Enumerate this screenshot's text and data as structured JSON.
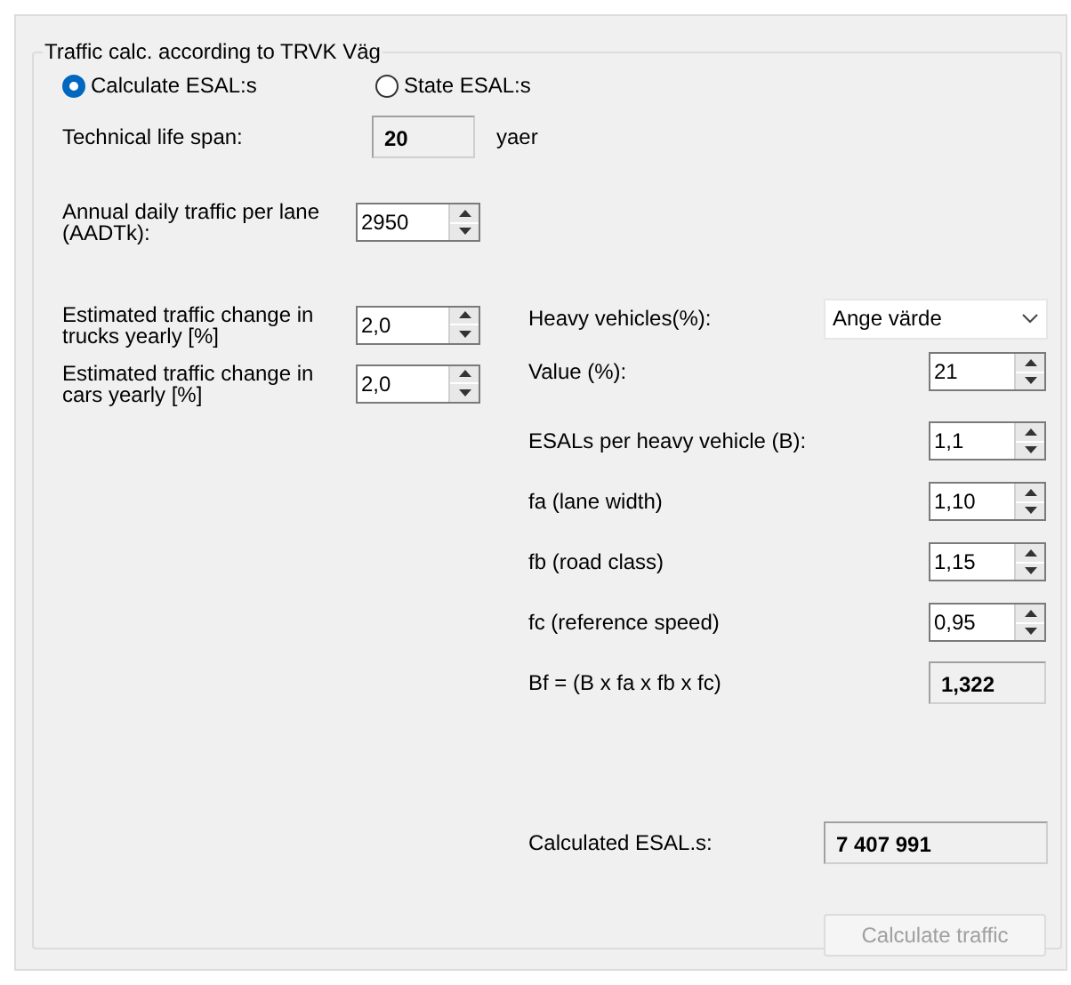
{
  "group_title": "Traffic calc. according to TRVK Väg",
  "modes": [
    {
      "label": "Calculate ESAL:s",
      "selected": true
    },
    {
      "label": "State ESAL:s",
      "selected": false
    }
  ],
  "life_span": {
    "label": "Technical life span:",
    "value": "20",
    "unit": "yaer"
  },
  "aadt": {
    "label": "Annual daily traffic per lane (AADTk):",
    "value": "2950"
  },
  "changes": [
    {
      "label": "Estimated traffic change in trucks yearly [%]",
      "value": "2,0"
    },
    {
      "label": "Estimated traffic change in cars yearly [%]",
      "value": "2,0"
    }
  ],
  "heavy": {
    "label": "Heavy vehicles(%):",
    "value": "Ange värde"
  },
  "params": [
    {
      "label": "Value (%):",
      "value": "21",
      "kind": "spin"
    },
    {
      "label": "ESALs per heavy vehicle (B):",
      "value": "1,1",
      "kind": "spin"
    },
    {
      "label": "fa (lane width)",
      "value": "1,10",
      "kind": "spin"
    },
    {
      "label": "fb (road class)",
      "value": "1,15",
      "kind": "spin"
    },
    {
      "label": "fc (reference speed)",
      "value": "0,95",
      "kind": "spin"
    },
    {
      "label": "Bf = (B x fa x fb x fc)",
      "value": "1,322",
      "kind": "readonly"
    }
  ],
  "result": {
    "label": "Calculated ESAL.s:",
    "value": "7 407 991"
  },
  "button": {
    "label": "Calculate traffic",
    "disabled": true
  }
}
